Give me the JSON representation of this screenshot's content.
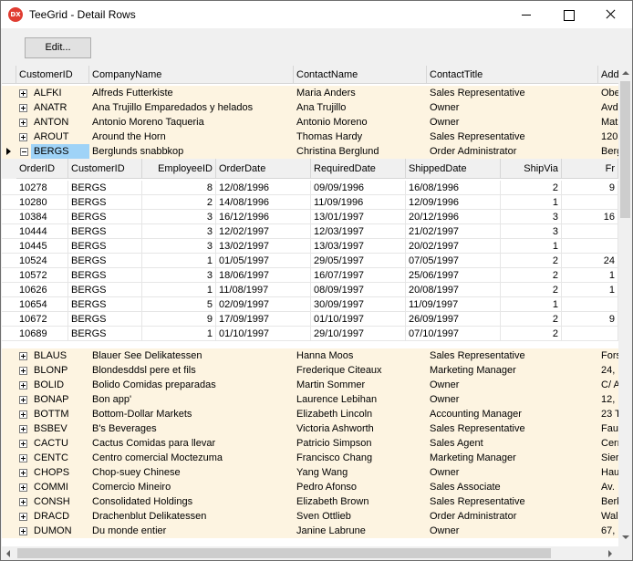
{
  "window": {
    "title": "TeeGrid - Detail Rows",
    "icon_label": "DX"
  },
  "toolbar": {
    "edit_label": "Edit..."
  },
  "master": {
    "columns": [
      "CustomerID",
      "CompanyName",
      "ContactName",
      "ContactTitle",
      "Add"
    ],
    "rows_top": [
      {
        "id": "ALFKI",
        "company": "Alfreds Futterkiste",
        "contact": "Maria Anders",
        "title": "Sales Representative",
        "addr": "Obe"
      },
      {
        "id": "ANATR",
        "company": "Ana Trujillo Emparedados y helados",
        "contact": "Ana Trujillo",
        "title": "Owner",
        "addr": "Avd"
      },
      {
        "id": "ANTON",
        "company": "Antonio Moreno Taqueria",
        "contact": "Antonio Moreno",
        "title": "Owner",
        "addr": "Mat"
      },
      {
        "id": "AROUT",
        "company": "Around the Horn",
        "contact": "Thomas Hardy",
        "title": "Sales Representative",
        "addr": "120"
      },
      {
        "id": "BERGS",
        "company": "Berglunds snabbkop",
        "contact": "Christina Berglund",
        "title": "Order Administrator",
        "addr": "Berg"
      }
    ],
    "rows_bottom": [
      {
        "id": "BLAUS",
        "company": "Blauer See Delikatessen",
        "contact": "Hanna Moos",
        "title": "Sales Representative",
        "addr": "Fors"
      },
      {
        "id": "BLONP",
        "company": "Blondesddsl pere et fils",
        "contact": "Frederique Citeaux",
        "title": "Marketing Manager",
        "addr": "24,"
      },
      {
        "id": "BOLID",
        "company": "Bolido Comidas preparadas",
        "contact": "Martin Sommer",
        "title": "Owner",
        "addr": "C/ A"
      },
      {
        "id": "BONAP",
        "company": "Bon app'",
        "contact": "Laurence Lebihan",
        "title": "Owner",
        "addr": "12,"
      },
      {
        "id": "BOTTM",
        "company": "Bottom-Dollar Markets",
        "contact": "Elizabeth Lincoln",
        "title": "Accounting Manager",
        "addr": "23 T"
      },
      {
        "id": "BSBEV",
        "company": "B's Beverages",
        "contact": "Victoria Ashworth",
        "title": "Sales Representative",
        "addr": "Fau"
      },
      {
        "id": "CACTU",
        "company": "Cactus Comidas para llevar",
        "contact": "Patricio Simpson",
        "title": "Sales Agent",
        "addr": "Cerr"
      },
      {
        "id": "CENTC",
        "company": "Centro comercial Moctezuma",
        "contact": "Francisco Chang",
        "title": "Marketing Manager",
        "addr": "Sier"
      },
      {
        "id": "CHOPS",
        "company": "Chop-suey Chinese",
        "contact": "Yang Wang",
        "title": "Owner",
        "addr": "Hau"
      },
      {
        "id": "COMMI",
        "company": "Comercio Mineiro",
        "contact": "Pedro Afonso",
        "title": "Sales Associate",
        "addr": "Av."
      },
      {
        "id": "CONSH",
        "company": "Consolidated Holdings",
        "contact": "Elizabeth Brown",
        "title": "Sales Representative",
        "addr": "Berk"
      },
      {
        "id": "DRACD",
        "company": "Drachenblut Delikatessen",
        "contact": "Sven Ottlieb",
        "title": "Order Administrator",
        "addr": "Wal"
      },
      {
        "id": "DUMON",
        "company": "Du monde entier",
        "contact": "Janine Labrune",
        "title": "Owner",
        "addr": "67,"
      }
    ]
  },
  "detail": {
    "columns": [
      "OrderID",
      "CustomerID",
      "EmployeeID",
      "OrderDate",
      "RequiredDate",
      "ShippedDate",
      "ShipVia",
      "Fr"
    ],
    "rows": [
      {
        "order": "10278",
        "cust": "BERGS",
        "emp": "8",
        "odate": "12/08/1996",
        "rdate": "09/09/1996",
        "sdate": "16/08/1996",
        "via": "2",
        "fr": "9"
      },
      {
        "order": "10280",
        "cust": "BERGS",
        "emp": "2",
        "odate": "14/08/1996",
        "rdate": "11/09/1996",
        "sdate": "12/09/1996",
        "via": "1",
        "fr": ""
      },
      {
        "order": "10384",
        "cust": "BERGS",
        "emp": "3",
        "odate": "16/12/1996",
        "rdate": "13/01/1997",
        "sdate": "20/12/1996",
        "via": "3",
        "fr": "16"
      },
      {
        "order": "10444",
        "cust": "BERGS",
        "emp": "3",
        "odate": "12/02/1997",
        "rdate": "12/03/1997",
        "sdate": "21/02/1997",
        "via": "3",
        "fr": ""
      },
      {
        "order": "10445",
        "cust": "BERGS",
        "emp": "3",
        "odate": "13/02/1997",
        "rdate": "13/03/1997",
        "sdate": "20/02/1997",
        "via": "1",
        "fr": ""
      },
      {
        "order": "10524",
        "cust": "BERGS",
        "emp": "1",
        "odate": "01/05/1997",
        "rdate": "29/05/1997",
        "sdate": "07/05/1997",
        "via": "2",
        "fr": "24"
      },
      {
        "order": "10572",
        "cust": "BERGS",
        "emp": "3",
        "odate": "18/06/1997",
        "rdate": "16/07/1997",
        "sdate": "25/06/1997",
        "via": "2",
        "fr": "1"
      },
      {
        "order": "10626",
        "cust": "BERGS",
        "emp": "1",
        "odate": "11/08/1997",
        "rdate": "08/09/1997",
        "sdate": "20/08/1997",
        "via": "2",
        "fr": "1"
      },
      {
        "order": "10654",
        "cust": "BERGS",
        "emp": "5",
        "odate": "02/09/1997",
        "rdate": "30/09/1997",
        "sdate": "11/09/1997",
        "via": "1",
        "fr": ""
      },
      {
        "order": "10672",
        "cust": "BERGS",
        "emp": "9",
        "odate": "17/09/1997",
        "rdate": "01/10/1997",
        "sdate": "26/09/1997",
        "via": "2",
        "fr": "9"
      },
      {
        "order": "10689",
        "cust": "BERGS",
        "emp": "1",
        "odate": "01/10/1997",
        "rdate": "29/10/1997",
        "sdate": "07/10/1997",
        "via": "2",
        "fr": ""
      }
    ]
  }
}
